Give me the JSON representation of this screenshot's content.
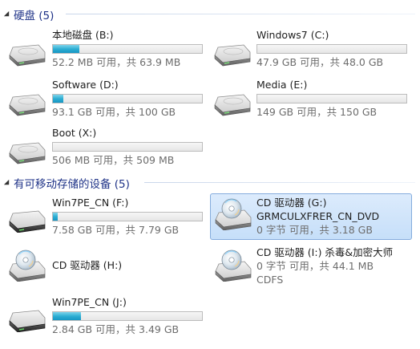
{
  "groups": [
    {
      "title": "硬盘 (5)",
      "drives": [
        {
          "name": "本地磁盘 (B:)",
          "used_fraction": 0.18,
          "space": "52.2 MB 可用，共 63.9 MB",
          "icon": "hard-drive-icon"
        },
        {
          "name": "Windows7 (C:)",
          "used_fraction": 0.0,
          "space": "47.9 GB 可用，共 48.0 GB",
          "icon": "hard-drive-icon"
        },
        {
          "name": "Software (D:)",
          "used_fraction": 0.07,
          "space": "93.1 GB 可用，共 100 GB",
          "icon": "hard-drive-icon"
        },
        {
          "name": "Media (E:)",
          "used_fraction": 0.0,
          "space": "149 GB 可用，共 150 GB",
          "icon": "hard-drive-icon"
        },
        {
          "name": "Boot (X:)",
          "used_fraction": 0.0,
          "space": "506 MB 可用，共 509 MB",
          "icon": "hard-drive-icon"
        }
      ]
    },
    {
      "title": "有可移动存储的设备 (5)",
      "drives": [
        {
          "name": "Win7PE_CN (F:)",
          "used_fraction": 0.03,
          "space": "7.58 GB 可用，共 7.79 GB",
          "icon": "removable-drive-icon"
        },
        {
          "name": "CD 驱动器 (G:)",
          "label": "GRMCULXFRER_CN_DVD",
          "space": "0 字节 可用，共 3.18 GB",
          "icon": "cd-drive-icon",
          "selected": true
        },
        {
          "name": "CD 驱动器 (H:)",
          "icon": "cd-drive-icon"
        },
        {
          "name": "CD 驱动器 (I:) 杀毒&加密大师",
          "space": "0 字节 可用，共 44.1 MB",
          "filesystem": "CDFS",
          "icon": "cd-drive-icon"
        },
        {
          "name": "Win7PE_CN (J:)",
          "used_fraction": 0.19,
          "space": "2.84 GB 可用，共 3.49 GB",
          "icon": "removable-drive-icon"
        }
      ]
    }
  ],
  "colors": {
    "group_title": "#1e3287",
    "bar_fill": "#26a9d2",
    "selection_bg": "#cfe4fb",
    "selection_border": "#84acdd"
  }
}
